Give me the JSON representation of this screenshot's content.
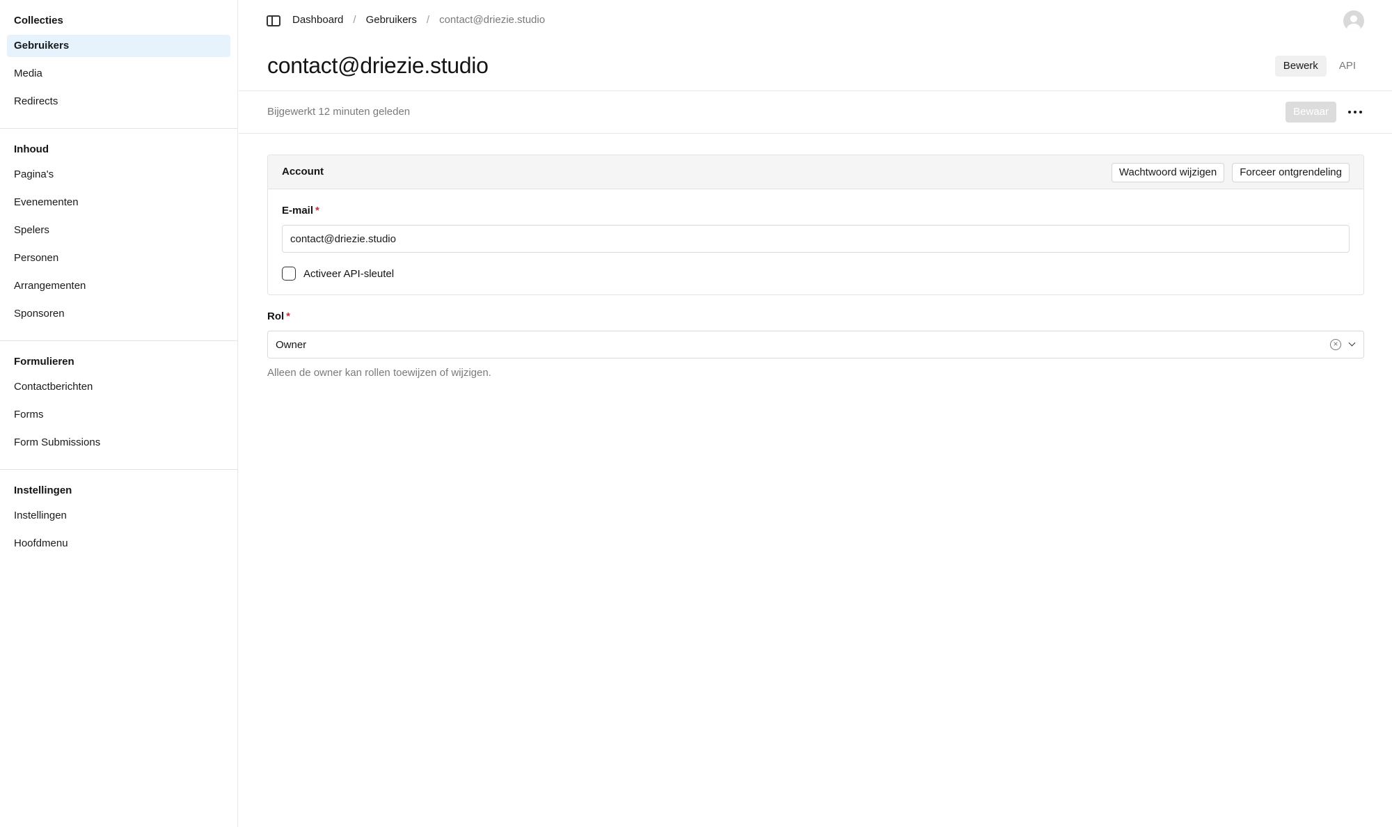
{
  "sidebar": {
    "groups": [
      {
        "title": "Collecties",
        "items": [
          "Gebruikers",
          "Media",
          "Redirects"
        ]
      },
      {
        "title": "Inhoud",
        "items": [
          "Pagina's",
          "Evenementen",
          "Spelers",
          "Personen",
          "Arrangementen",
          "Sponsoren"
        ]
      },
      {
        "title": "Formulieren",
        "items": [
          "Contactberichten",
          "Forms",
          "Form Submissions"
        ]
      },
      {
        "title": "Instellingen",
        "items": [
          "Instellingen",
          "Hoofdmenu"
        ]
      }
    ],
    "active_item": "Gebruikers"
  },
  "breadcrumb": [
    "Dashboard",
    "Gebruikers",
    "contact@driezie.studio"
  ],
  "breadcrumb_separator": "/",
  "page": {
    "title": "contact@driezie.studio",
    "tabs": [
      "Bewerk",
      "API"
    ],
    "updated": "Bijgewerkt 12 minuten geleden",
    "save_label": "Bewaar"
  },
  "account": {
    "title": "Account",
    "change_password_label": "Wachtwoord wijzigen",
    "force_unlock_label": "Forceer ontgrendeling",
    "email_label": "E-mail",
    "email_value": "contact@driezie.studio",
    "api_key_label": "Activeer API-sleutel",
    "api_key_checked": false
  },
  "role": {
    "label": "Rol",
    "value": "Owner",
    "help": "Alleen de owner kan rollen toewijzen of wijzigen."
  },
  "required_marker": "*",
  "colors": {
    "active_nav_bg": "#e6f2fc",
    "required": "#d12b2b",
    "save_disabled_bg": "#dcdcdc"
  }
}
